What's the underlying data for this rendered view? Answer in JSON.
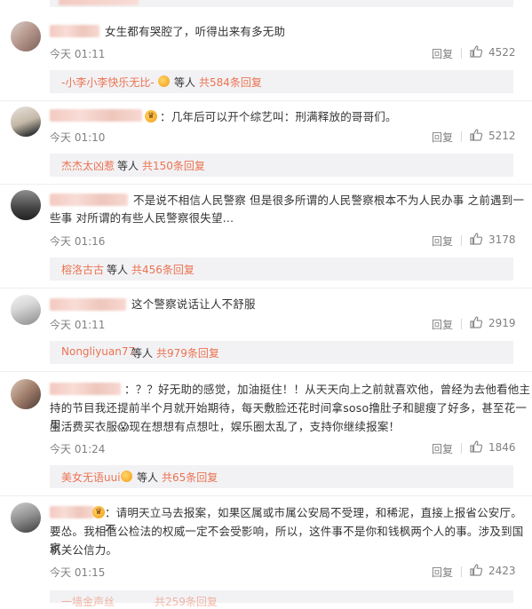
{
  "labels": {
    "reply": "回复",
    "deng_ren": "等人",
    "vip_glyph": "♛"
  },
  "icons": {
    "like": "thumbs-up-icon",
    "vip": "vip-crown-icon"
  },
  "comments": [
    {
      "text": "女生都有哭腔了，听得出来有多无助",
      "time": "今天 01:11",
      "likes": "4522",
      "sub_name": "-小李小李快乐无比-",
      "sub_total": "共584条回复"
    },
    {
      "text": "：几年后可以开个综艺叫：刑满释放的哥哥们。",
      "time": "今天 01:10",
      "likes": "5212",
      "sub_name": "杰杰太凶惹",
      "sub_total": "共150条回复"
    },
    {
      "text_line1": "不是说不相信人民警察 但是很多所谓的人民警察根本不为人民办事 之前遇到一",
      "text_line2": "些事 对所谓的有些人民警察很失望…",
      "time": "今天 01:16",
      "likes": "3178",
      "sub_name": "榕洛古古",
      "sub_total": "共456条回复"
    },
    {
      "text": "这个警察说话让人不舒服",
      "time": "今天 01:11",
      "likes": "2919",
      "sub_name": "Nongliyuan77",
      "sub_total": "共979条回复"
    },
    {
      "text_line1": "：？？好无助的感觉，加油挺住！！从天天向上之前就喜欢他，曾经为去他看他主",
      "text_line2": "持的节目我还提前半个月就开始期待，每天敷脸还花时间拿soso撸肚子和腿瘦了好多，甚至花一周",
      "text_line3": "生活费买衣服😱现在想想有点想吐，娱乐圈太乱了，支持你继续报案！",
      "time": "今天 01:24",
      "likes": "1846",
      "sub_name": "美女无语uui",
      "sub_total": "共65条回复"
    },
    {
      "text_line1": "：请明天立马去报案，如果区属或市属公安局不受理，和稀泥，直接上报省公安厅。不",
      "text_line2": "要怂。我相信公检法的权威一定不会受影响，所以，这件事不是你和钱枫两个人的事。涉及到国家",
      "text_line3": "机关公信力。",
      "time": "今天 01:15",
      "likes": "2423",
      "sub_name": "一墙金声丝",
      "sub_total": "共259条回复"
    }
  ]
}
